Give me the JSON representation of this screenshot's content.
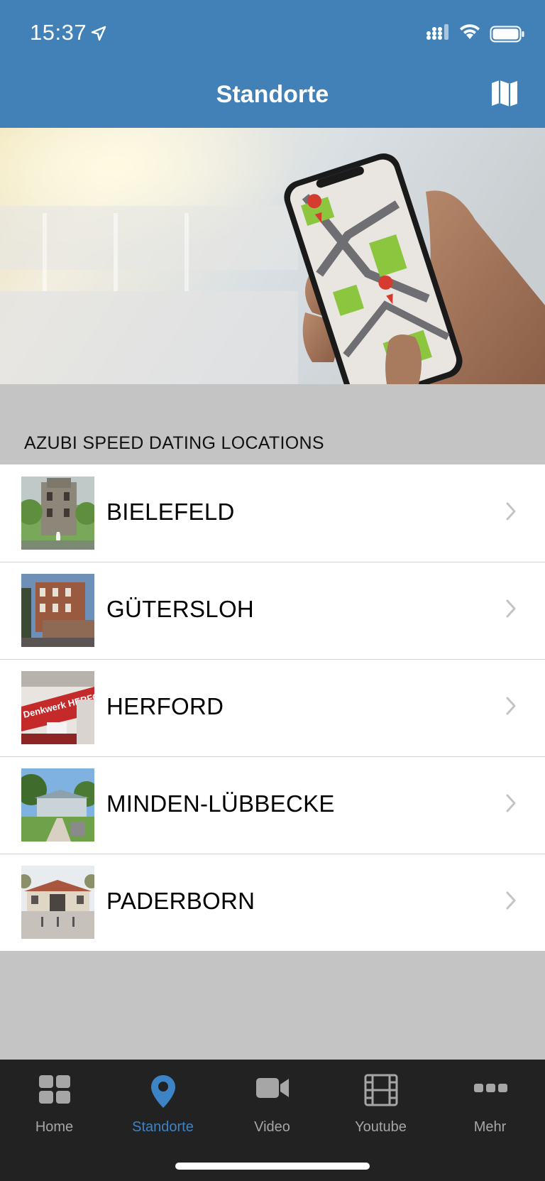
{
  "status_bar": {
    "time": "15:37"
  },
  "nav": {
    "title": "Standorte",
    "map_icon": "map-icon"
  },
  "section": {
    "header": "AZUBI SPEED DATING LOCATIONS"
  },
  "locations": [
    {
      "name": "BIELEFELD"
    },
    {
      "name": "GÜTERSLOH"
    },
    {
      "name": "HERFORD"
    },
    {
      "name": "MINDEN-LÜBBECKE"
    },
    {
      "name": "PADERBORN"
    }
  ],
  "thumb_texts": {
    "herford_sign": "Denkwerk HERFORD"
  },
  "tabs": [
    {
      "label": "Home",
      "icon": "grid-icon"
    },
    {
      "label": "Standorte",
      "icon": "location-pin-icon",
      "active": true
    },
    {
      "label": "Video",
      "icon": "video-camera-icon"
    },
    {
      "label": "Youtube",
      "icon": "film-icon"
    },
    {
      "label": "Mehr",
      "icon": "more-icon"
    }
  ],
  "colors": {
    "header_blue": "#4181b8",
    "tab_active": "#3d84c6",
    "tab_bar": "#222222",
    "background": "#c4c4c4"
  }
}
